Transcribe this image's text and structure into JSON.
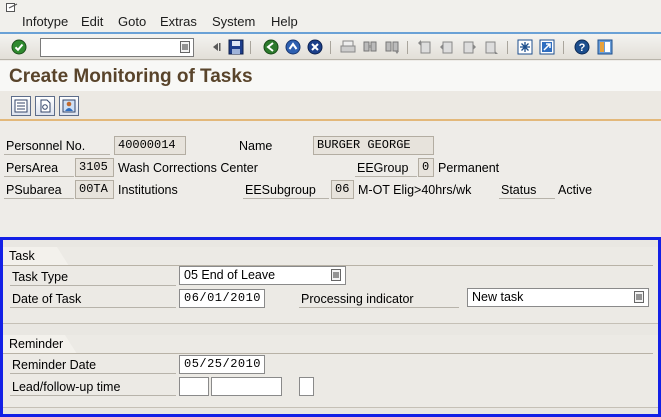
{
  "menu": {
    "items": [
      "Infotype",
      "Edit",
      "Goto",
      "Extras",
      "System",
      "Help"
    ]
  },
  "toolbar": {
    "command_value": "",
    "icons": [
      "enter-icon",
      "back-icon",
      "save-icon",
      "back-nav-icon",
      "exit-icon",
      "cancel-icon",
      "print-icon",
      "find-icon",
      "find-next-icon",
      "first-page-icon",
      "prev-page-icon",
      "next-page-icon",
      "last-page-icon",
      "create-session-icon",
      "shortcut-icon",
      "help-icon",
      "layout-icon"
    ]
  },
  "title": "Create Monitoring of Tasks",
  "header": {
    "personnel_no_label": "Personnel No.",
    "personnel_no": "40000014",
    "name_label": "Name",
    "name": "BURGER GEORGE",
    "persarea_label": "PersArea",
    "persarea_code": "3105",
    "persarea_text": "Wash Corrections Center",
    "eegroup_label": "EEGroup",
    "eegroup_code": "0",
    "eegroup_text": "Permanent",
    "psubarea_label": "PSubarea",
    "psubarea_code": "00TA",
    "psubarea_text": "Institutions",
    "eesubgroup_label": "EESubgroup",
    "eesubgroup_code": "06",
    "eesubgroup_text": "M-OT Elig>40hrs/wk",
    "status_label": "Status",
    "status_text": "Active"
  },
  "task": {
    "group_title": "Task",
    "task_type_label": "Task Type",
    "task_type_value": "05 End of Leave",
    "date_label": "Date of Task",
    "date_value": "06/01/2010",
    "processing_label": "Processing indicator",
    "processing_value": "New task"
  },
  "reminder": {
    "group_title": "Reminder",
    "reminder_date_label": "Reminder Date",
    "reminder_date_value": "05/25/2010",
    "lead_label": "Lead/follow-up time",
    "lead_value": "",
    "lead_unit": "",
    "lead_sign": ""
  },
  "colors": {
    "title": "#59442b",
    "frame_border": "#1320e6",
    "toolbar_accent": "#6aa1d6"
  }
}
